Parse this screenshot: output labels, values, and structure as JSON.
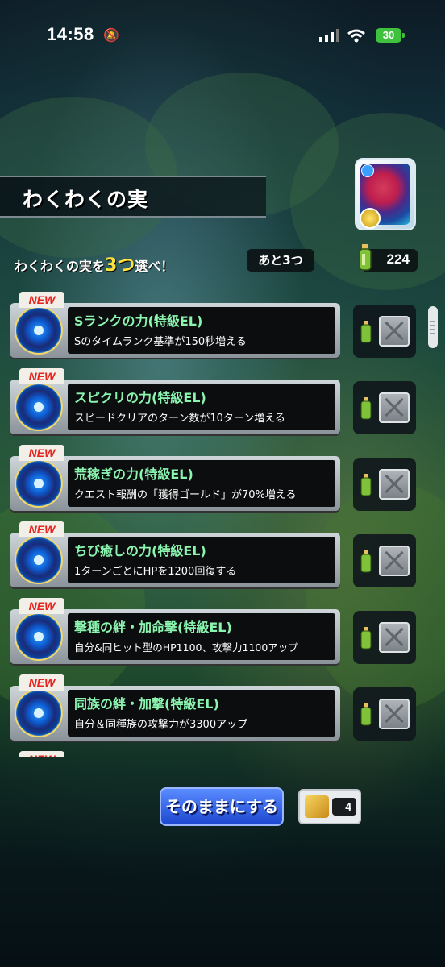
{
  "status_bar": {
    "time": "14:58",
    "battery": "30"
  },
  "header": {
    "title": "わくわくの実"
  },
  "selection": {
    "prompt_prefix": "わくわくの実を",
    "prompt_count": "3つ",
    "prompt_suffix": "選べ！",
    "remaining": "あと3つ",
    "fruit_count": "224"
  },
  "items": [
    {
      "badge": "NEW",
      "name": "Sランクの力(特級EL)",
      "description": "Sのタイムランク基準が150秒増える"
    },
    {
      "badge": "NEW",
      "name": "スピクリの力(特級EL)",
      "description": "スピードクリアのターン数が10ターン増える"
    },
    {
      "badge": "NEW",
      "name": "荒稼ぎの力(特級EL)",
      "description": "クエスト報酬の「獲得ゴールド」が70%増える"
    },
    {
      "badge": "NEW",
      "name": "ちび癒しの力(特級EL)",
      "description": "1ターンごとにHPを1200回復する"
    },
    {
      "badge": "NEW",
      "name": "撃種の絆・加命撃(特級EL)",
      "description": "自分&同ヒット型のHP1100、攻撃力1100アップ"
    },
    {
      "badge": "NEW",
      "name": "同族の絆・加撃(特級EL)",
      "description": "自分＆同種族の攻撃力が3300アップ"
    },
    {
      "badge": "NEW",
      "name": "",
      "description": ""
    }
  ],
  "footer": {
    "keep_button": "そのままにする",
    "ticket_count": "4"
  }
}
